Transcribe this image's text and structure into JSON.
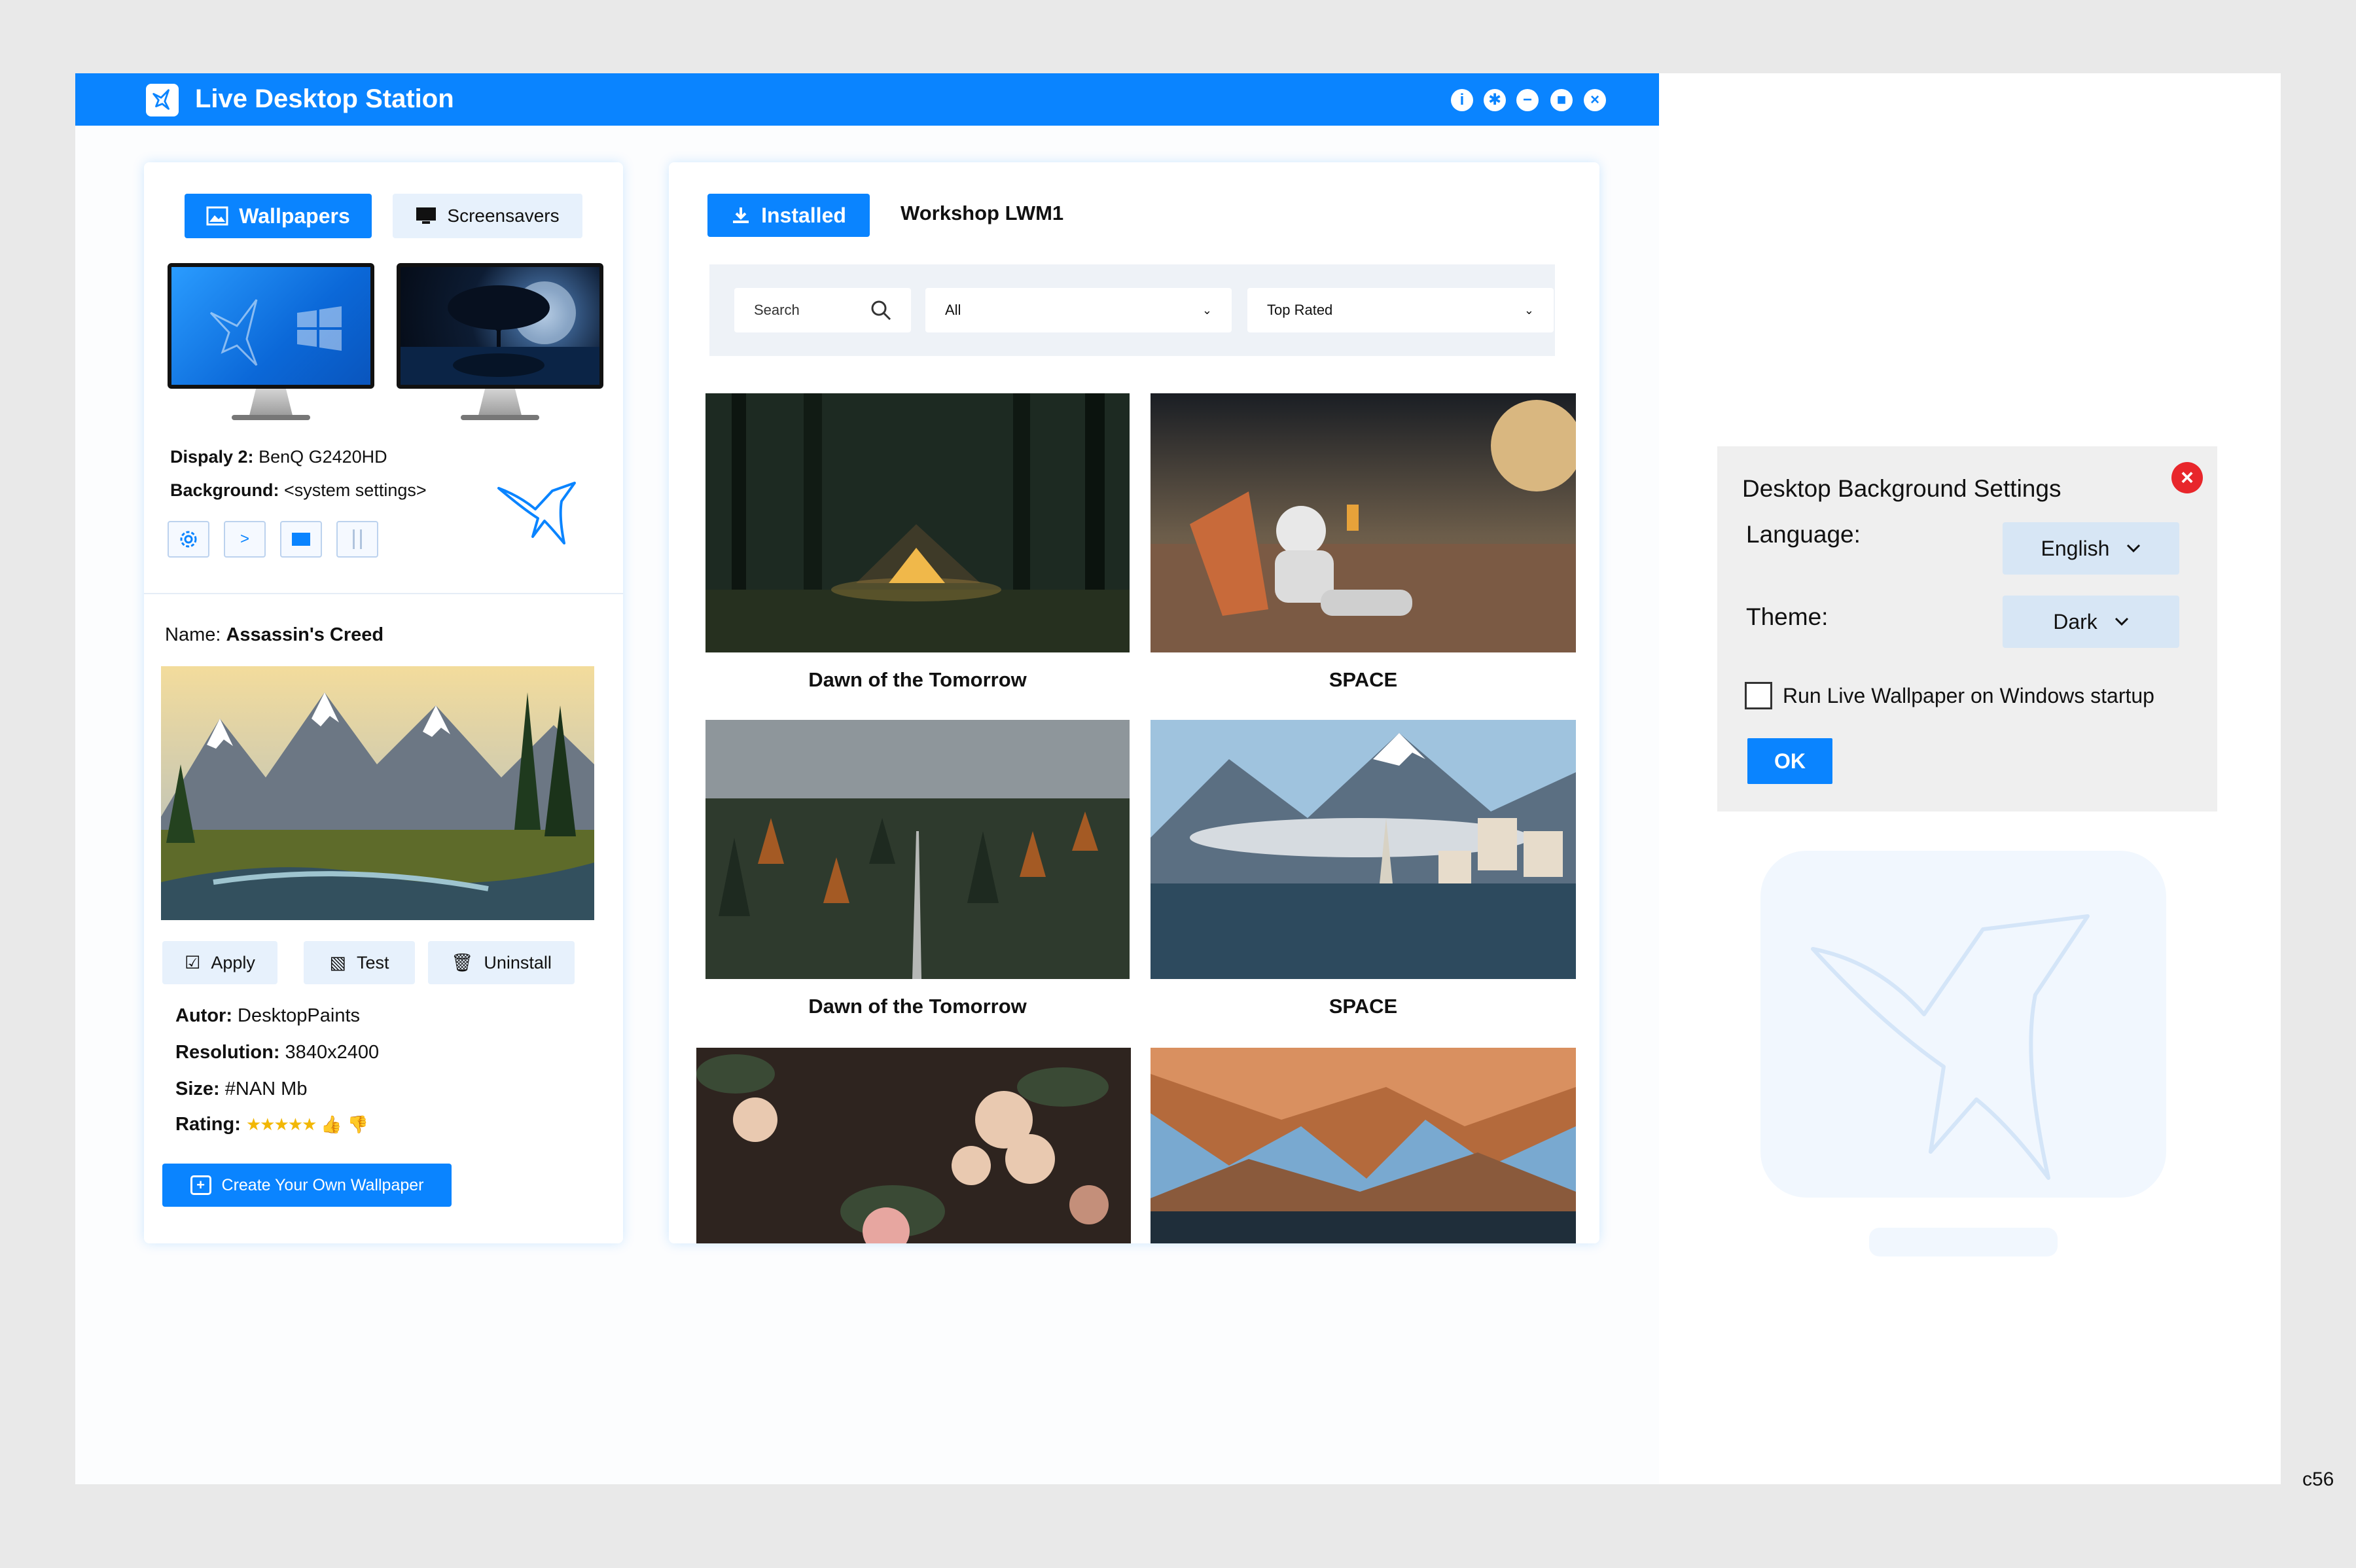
{
  "app": {
    "title": "Live Desktop Station"
  },
  "window_controls": [
    {
      "name": "info-icon",
      "glyph": "i"
    },
    {
      "name": "gear-icon",
      "glyph": "⚙"
    },
    {
      "name": "minimize-icon",
      "glyph": "−"
    },
    {
      "name": "maximize-icon",
      "glyph": "■"
    },
    {
      "name": "close-icon",
      "glyph": "×"
    }
  ],
  "left": {
    "tabs": {
      "wallpapers": "Wallpapers",
      "screensavers": "Screensavers"
    },
    "display": {
      "label": "Dispaly 2:",
      "value": " BenQ G2420HD"
    },
    "background": {
      "label": "Background:",
      "value": " <system settings>"
    },
    "monitor_controls": [
      "gear-icon",
      "play-icon",
      "stop-icon",
      "pause-icon"
    ],
    "name": {
      "label": "Name: ",
      "value": "Assassin's Creed"
    },
    "actions": {
      "apply": "Apply",
      "test": "Test",
      "uninstall": "Uninstall"
    },
    "details": {
      "author_label": "Autor:",
      "author": " DesktopPaints",
      "resolution_label": "Resolution:",
      "resolution": " 3840x2400",
      "size_label": "Size:",
      "size": " #NAN Mb",
      "rating_label": "Rating:",
      "rating": 5
    },
    "create_button": "Create Your Own Wallpaper"
  },
  "center": {
    "tabs": {
      "installed": "Installed",
      "workshop": "Workshop LWM1"
    },
    "filters": {
      "search_placeholder": "Search",
      "category": "All",
      "sort": "Top Rated"
    },
    "wallpapers": [
      {
        "title": "Dawn of the Tomorrow"
      },
      {
        "title": "SPACE"
      },
      {
        "title": "Dawn of the Tomorrow"
      },
      {
        "title": "SPACE"
      },
      {
        "title": ""
      },
      {
        "title": ""
      }
    ]
  },
  "settings": {
    "title": "Desktop Background Settings",
    "language_label": "Language:",
    "language": "English",
    "theme_label": "Theme:",
    "theme": "Dark",
    "startup_label": "Run Live Wallpaper on Windows startup",
    "startup_checked": false,
    "ok": "OK"
  },
  "corner_code": "c56",
  "colors": {
    "accent": "#0a84ff",
    "close": "#e8262b"
  }
}
